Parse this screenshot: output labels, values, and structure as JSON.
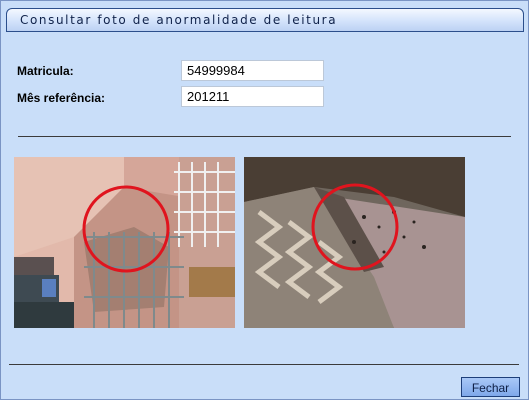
{
  "window": {
    "title": "Consultar foto de anormalidade de leitura"
  },
  "form": {
    "matricula_label": "Matricula:",
    "matricula_value": "54999984",
    "mes_label": "Mês referência:",
    "mes_value": "201211"
  },
  "photos": [
    {
      "name": "photo-1",
      "highlight_color": "#e0141e"
    },
    {
      "name": "photo-2",
      "highlight_color": "#e0141e"
    }
  ],
  "footer": {
    "close_label": "Fechar"
  },
  "colors": {
    "background": "#c9def9",
    "title_border": "#2c4f8c",
    "button": "#7fa8ea"
  }
}
